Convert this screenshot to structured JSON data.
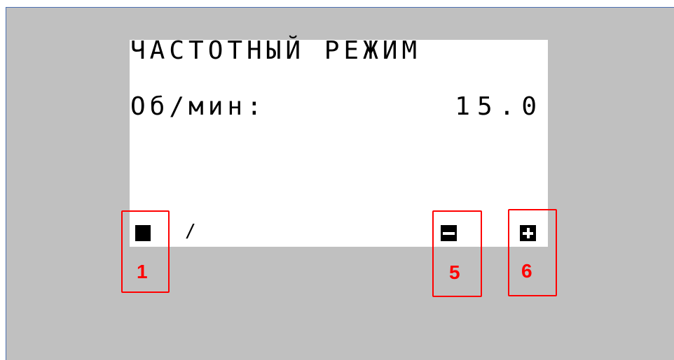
{
  "display": {
    "title": "ЧАСТОТНЫЙ РЕЖИМ",
    "rpm_label": "Об/мин:",
    "rpm_value": "15.0",
    "softkey_separator": "/"
  },
  "softkeys": [
    {
      "marker": "1",
      "icon": "stop-square-icon"
    },
    {
      "marker": "5",
      "icon": "minus-box-icon"
    },
    {
      "marker": "6",
      "icon": "plus-box-icon"
    }
  ],
  "colors": {
    "background": "#c0c0c0",
    "screen": "#ffffff",
    "highlight": "#ff0000",
    "text": "#000000"
  }
}
